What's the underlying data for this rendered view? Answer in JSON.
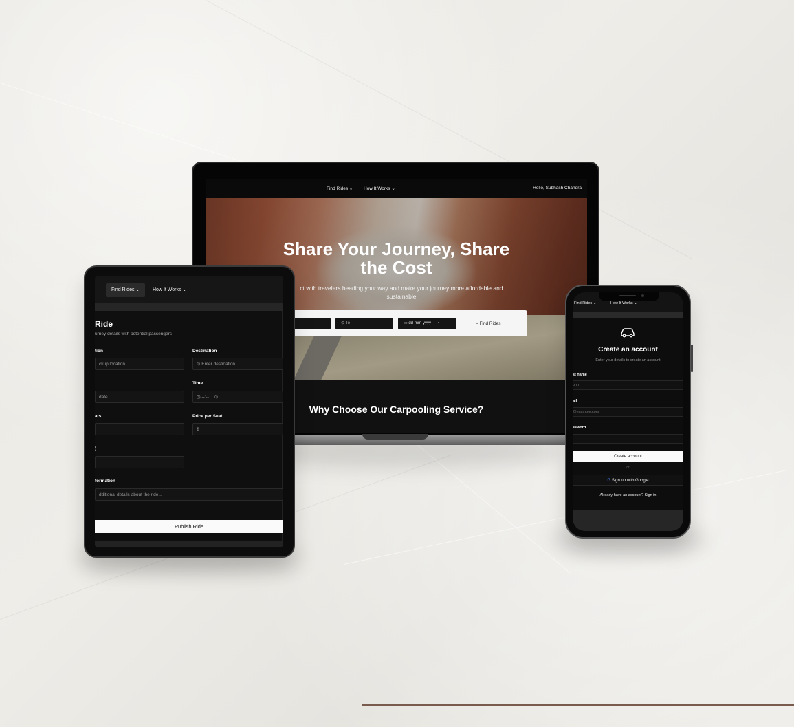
{
  "laptop": {
    "nav": {
      "find_rides": "Find Rides ⌄",
      "how_it_works": "How It Works ⌄",
      "greeting": "Hello, Subhash Chandra"
    },
    "hero": {
      "title_line1": "Share Your Journey, Share",
      "title_line2": "the Cost",
      "subtitle_line1": "ct with travelers heading your way and make your journey more affordable and",
      "subtitle_line2": "sustainable"
    },
    "search": {
      "to_placeholder": "To",
      "date_placeholder": "dd-mm-yyyy",
      "find_button": "Find Rides"
    },
    "section_title": "Why Choose Our Carpooling Service?"
  },
  "tablet": {
    "nav": {
      "find_rides": "Find Rides ⌄",
      "how_it_works": "How It Works ⌄"
    },
    "title": "Ride",
    "description": "urney details with potential passengers",
    "fields": {
      "location_label": "tion",
      "location_placeholder": "ckup location",
      "destination_label": "Destination",
      "destination_placeholder": "Enter destination",
      "date_placeholder": "date",
      "time_label": "Time",
      "time_placeholder": "--:--",
      "seats_label": "ats",
      "price_label": "Price per Seat",
      "price_placeholder": "$",
      "extra_label": ")",
      "info_label": "formation",
      "info_placeholder": "dditional details about the ride..."
    },
    "publish_button": "Publish Ride"
  },
  "phone": {
    "nav": {
      "find_rides": "Find Rides ⌄",
      "how_it_works": "How It Works ⌄"
    },
    "title": "Create an account",
    "subtitle": "Enter your details to create an account",
    "fields": {
      "first_name_label": "st name",
      "first_name_placeholder": "ohn",
      "email_label": "ail",
      "email_placeholder": "@example.com",
      "password_label": "ssword"
    },
    "create_button": "Create account",
    "or": "or",
    "google_button": "Sign up with Google",
    "signin_text": "Already have an account? Sign in"
  }
}
